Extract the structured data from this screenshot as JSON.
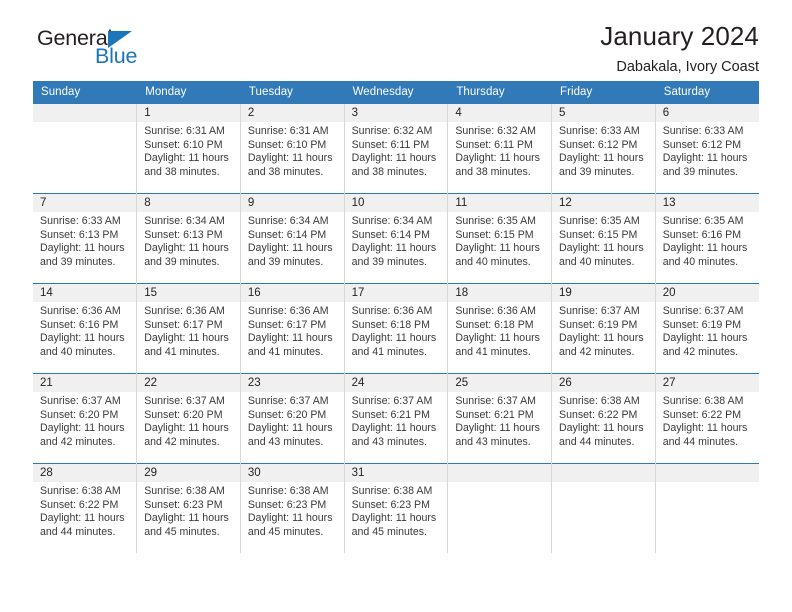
{
  "brand": {
    "name_part1": "General",
    "name_part2": "Blue",
    "accent_color": "#1b75bb"
  },
  "header": {
    "title": "January 2024",
    "subtitle": "Dabakala, Ivory Coast"
  },
  "colors": {
    "header_row_bg": "#3279b7",
    "daynum_band_bg": "#f0f0f0",
    "cell_border": "#d7d7d7",
    "week_separator": "#3279b7",
    "text": "#231f20"
  },
  "weekdays": [
    "Sunday",
    "Monday",
    "Tuesday",
    "Wednesday",
    "Thursday",
    "Friday",
    "Saturday"
  ],
  "labels": {
    "sunrise_prefix": "Sunrise:",
    "sunset_prefix": "Sunset:",
    "daylight_prefix": "Daylight:"
  },
  "weeks": [
    [
      {
        "day": ""
      },
      {
        "day": "1",
        "line1": "Sunrise: 6:31 AM",
        "line2": "Sunset: 6:10 PM",
        "line3": "Daylight: 11 hours",
        "line4": "and 38 minutes."
      },
      {
        "day": "2",
        "line1": "Sunrise: 6:31 AM",
        "line2": "Sunset: 6:10 PM",
        "line3": "Daylight: 11 hours",
        "line4": "and 38 minutes."
      },
      {
        "day": "3",
        "line1": "Sunrise: 6:32 AM",
        "line2": "Sunset: 6:11 PM",
        "line3": "Daylight: 11 hours",
        "line4": "and 38 minutes."
      },
      {
        "day": "4",
        "line1": "Sunrise: 6:32 AM",
        "line2": "Sunset: 6:11 PM",
        "line3": "Daylight: 11 hours",
        "line4": "and 38 minutes."
      },
      {
        "day": "5",
        "line1": "Sunrise: 6:33 AM",
        "line2": "Sunset: 6:12 PM",
        "line3": "Daylight: 11 hours",
        "line4": "and 39 minutes."
      },
      {
        "day": "6",
        "line1": "Sunrise: 6:33 AM",
        "line2": "Sunset: 6:12 PM",
        "line3": "Daylight: 11 hours",
        "line4": "and 39 minutes."
      }
    ],
    [
      {
        "day": "7",
        "line1": "Sunrise: 6:33 AM",
        "line2": "Sunset: 6:13 PM",
        "line3": "Daylight: 11 hours",
        "line4": "and 39 minutes."
      },
      {
        "day": "8",
        "line1": "Sunrise: 6:34 AM",
        "line2": "Sunset: 6:13 PM",
        "line3": "Daylight: 11 hours",
        "line4": "and 39 minutes."
      },
      {
        "day": "9",
        "line1": "Sunrise: 6:34 AM",
        "line2": "Sunset: 6:14 PM",
        "line3": "Daylight: 11 hours",
        "line4": "and 39 minutes."
      },
      {
        "day": "10",
        "line1": "Sunrise: 6:34 AM",
        "line2": "Sunset: 6:14 PM",
        "line3": "Daylight: 11 hours",
        "line4": "and 39 minutes."
      },
      {
        "day": "11",
        "line1": "Sunrise: 6:35 AM",
        "line2": "Sunset: 6:15 PM",
        "line3": "Daylight: 11 hours",
        "line4": "and 40 minutes."
      },
      {
        "day": "12",
        "line1": "Sunrise: 6:35 AM",
        "line2": "Sunset: 6:15 PM",
        "line3": "Daylight: 11 hours",
        "line4": "and 40 minutes."
      },
      {
        "day": "13",
        "line1": "Sunrise: 6:35 AM",
        "line2": "Sunset: 6:16 PM",
        "line3": "Daylight: 11 hours",
        "line4": "and 40 minutes."
      }
    ],
    [
      {
        "day": "14",
        "line1": "Sunrise: 6:36 AM",
        "line2": "Sunset: 6:16 PM",
        "line3": "Daylight: 11 hours",
        "line4": "and 40 minutes."
      },
      {
        "day": "15",
        "line1": "Sunrise: 6:36 AM",
        "line2": "Sunset: 6:17 PM",
        "line3": "Daylight: 11 hours",
        "line4": "and 41 minutes."
      },
      {
        "day": "16",
        "line1": "Sunrise: 6:36 AM",
        "line2": "Sunset: 6:17 PM",
        "line3": "Daylight: 11 hours",
        "line4": "and 41 minutes."
      },
      {
        "day": "17",
        "line1": "Sunrise: 6:36 AM",
        "line2": "Sunset: 6:18 PM",
        "line3": "Daylight: 11 hours",
        "line4": "and 41 minutes."
      },
      {
        "day": "18",
        "line1": "Sunrise: 6:36 AM",
        "line2": "Sunset: 6:18 PM",
        "line3": "Daylight: 11 hours",
        "line4": "and 41 minutes."
      },
      {
        "day": "19",
        "line1": "Sunrise: 6:37 AM",
        "line2": "Sunset: 6:19 PM",
        "line3": "Daylight: 11 hours",
        "line4": "and 42 minutes."
      },
      {
        "day": "20",
        "line1": "Sunrise: 6:37 AM",
        "line2": "Sunset: 6:19 PM",
        "line3": "Daylight: 11 hours",
        "line4": "and 42 minutes."
      }
    ],
    [
      {
        "day": "21",
        "line1": "Sunrise: 6:37 AM",
        "line2": "Sunset: 6:20 PM",
        "line3": "Daylight: 11 hours",
        "line4": "and 42 minutes."
      },
      {
        "day": "22",
        "line1": "Sunrise: 6:37 AM",
        "line2": "Sunset: 6:20 PM",
        "line3": "Daylight: 11 hours",
        "line4": "and 42 minutes."
      },
      {
        "day": "23",
        "line1": "Sunrise: 6:37 AM",
        "line2": "Sunset: 6:20 PM",
        "line3": "Daylight: 11 hours",
        "line4": "and 43 minutes."
      },
      {
        "day": "24",
        "line1": "Sunrise: 6:37 AM",
        "line2": "Sunset: 6:21 PM",
        "line3": "Daylight: 11 hours",
        "line4": "and 43 minutes."
      },
      {
        "day": "25",
        "line1": "Sunrise: 6:37 AM",
        "line2": "Sunset: 6:21 PM",
        "line3": "Daylight: 11 hours",
        "line4": "and 43 minutes."
      },
      {
        "day": "26",
        "line1": "Sunrise: 6:38 AM",
        "line2": "Sunset: 6:22 PM",
        "line3": "Daylight: 11 hours",
        "line4": "and 44 minutes."
      },
      {
        "day": "27",
        "line1": "Sunrise: 6:38 AM",
        "line2": "Sunset: 6:22 PM",
        "line3": "Daylight: 11 hours",
        "line4": "and 44 minutes."
      }
    ],
    [
      {
        "day": "28",
        "line1": "Sunrise: 6:38 AM",
        "line2": "Sunset: 6:22 PM",
        "line3": "Daylight: 11 hours",
        "line4": "and 44 minutes."
      },
      {
        "day": "29",
        "line1": "Sunrise: 6:38 AM",
        "line2": "Sunset: 6:23 PM",
        "line3": "Daylight: 11 hours",
        "line4": "and 45 minutes."
      },
      {
        "day": "30",
        "line1": "Sunrise: 6:38 AM",
        "line2": "Sunset: 6:23 PM",
        "line3": "Daylight: 11 hours",
        "line4": "and 45 minutes."
      },
      {
        "day": "31",
        "line1": "Sunrise: 6:38 AM",
        "line2": "Sunset: 6:23 PM",
        "line3": "Daylight: 11 hours",
        "line4": "and 45 minutes."
      },
      {
        "day": ""
      },
      {
        "day": ""
      },
      {
        "day": ""
      }
    ]
  ]
}
